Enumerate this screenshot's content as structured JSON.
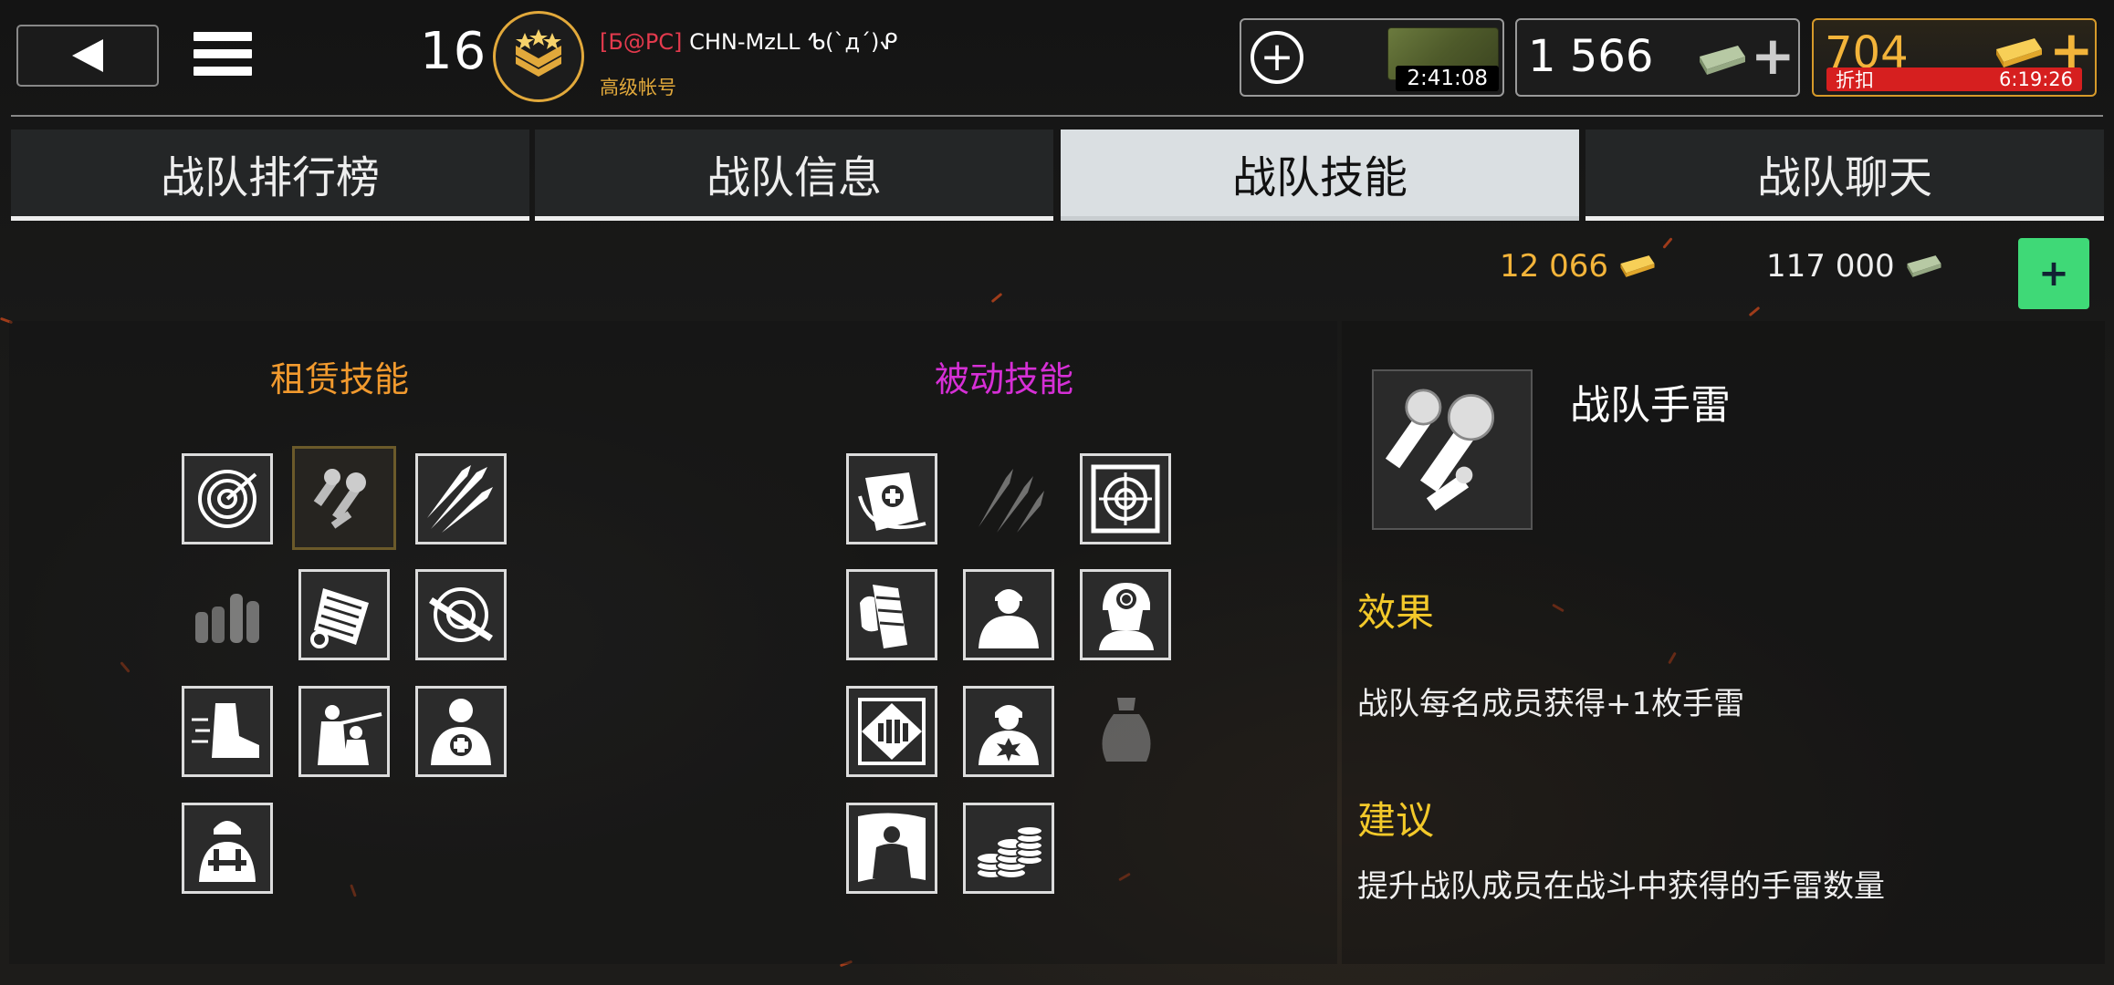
{
  "header": {
    "level": "16",
    "player_tag": "[Б@PC]",
    "player_name": "CHN-MzLL ᕹ(`д´)ᕵ",
    "account_type": "高级帐号",
    "crate_timer": "2:41:08",
    "cash": "1 566",
    "gold": "704",
    "discount_label": "折扣",
    "discount_timer": "6:19:26"
  },
  "tabs": [
    {
      "label": "战队排行榜",
      "active": false
    },
    {
      "label": "战队信息",
      "active": false
    },
    {
      "label": "战队技能",
      "active": true
    },
    {
      "label": "战队聊天",
      "active": false
    }
  ],
  "clan_funds": {
    "gold": "12 066",
    "cash": "117 000",
    "add_label": "+"
  },
  "sections": {
    "rent_title": "租赁技能",
    "passive_title": "被动技能"
  },
  "rent_skills": [
    {
      "icon": "radar-icon",
      "state": "active"
    },
    {
      "icon": "grenade-icon",
      "state": "selected"
    },
    {
      "icon": "rockets-icon",
      "state": "active"
    },
    {
      "icon": "ammo-icon",
      "state": "locked"
    },
    {
      "icon": "ammo-belt-icon",
      "state": "active"
    },
    {
      "icon": "rifle-target-icon",
      "state": "active"
    },
    {
      "icon": "boot-icon",
      "state": "active"
    },
    {
      "icon": "sniper-squad-icon",
      "state": "active"
    },
    {
      "icon": "medic-icon",
      "state": "active"
    },
    {
      "icon": "armored-soldier-icon",
      "state": "active"
    }
  ],
  "passive_skills": [
    {
      "icon": "medkit-bag-icon",
      "state": "active"
    },
    {
      "icon": "knives-icon",
      "state": "locked"
    },
    {
      "icon": "target-icon",
      "state": "active"
    },
    {
      "icon": "magazine-icon",
      "state": "active"
    },
    {
      "icon": "soldier-icon",
      "state": "active"
    },
    {
      "icon": "helmet-target-icon",
      "state": "active"
    },
    {
      "icon": "ammo-crate-icon",
      "state": "active"
    },
    {
      "icon": "explosive-vest-icon",
      "state": "active"
    },
    {
      "icon": "money-bag-icon",
      "state": "locked"
    },
    {
      "icon": "flag-soldier-icon",
      "state": "active"
    },
    {
      "icon": "coins-icon",
      "state": "active"
    }
  ],
  "detail": {
    "name": "战队手雷",
    "icon": "grenade-icon",
    "effect_heading": "效果",
    "effect_text": "战队每名成员获得+1枚手雷",
    "advice_heading": "建议",
    "advice_text": "提升战队成员在战斗中获得的手雷数量"
  },
  "colors": {
    "rent_title": "#f29a2e",
    "passive_title": "#d62fd6",
    "gold": "#f3b43a",
    "add_button": "#3fd977",
    "discount": "#d61f1f",
    "detail_heading": "#f3c92a"
  }
}
